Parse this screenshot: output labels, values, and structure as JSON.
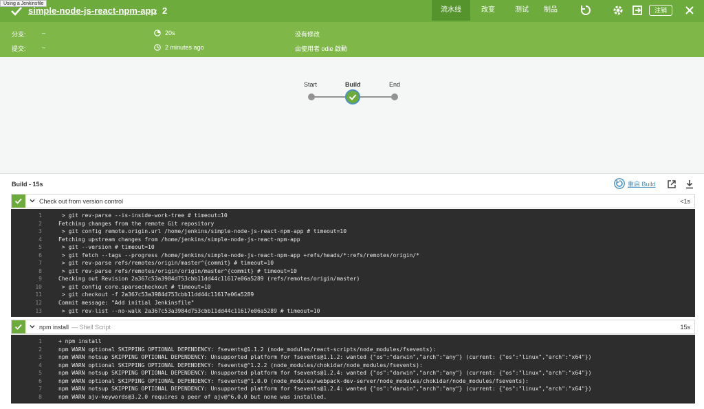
{
  "tooltip": "Using a Jenkinsfile",
  "header": {
    "pipeline_name": "simple-node-js-react-npm-app",
    "run_number": "2",
    "tabs": [
      "流水线",
      "改变",
      "测试",
      "制品"
    ],
    "logout_label": "注销"
  },
  "meta": {
    "branch_label": "分支:",
    "branch_value": "–",
    "commit_label": "提交:",
    "commit_value": "–",
    "duration": "20s",
    "started": "2 minutes ago",
    "changes": "没有修改",
    "started_by": "由使用者 odie 啟動"
  },
  "pipeline_graph": {
    "stages": [
      "Start",
      "Build",
      "End"
    ]
  },
  "build_panel": {
    "title": "Build - 15s",
    "restart_label": "重启 Build"
  },
  "steps": [
    {
      "name": "Check out from version control",
      "subtitle": "",
      "duration": "<1s",
      "log": [
        " > git rev-parse --is-inside-work-tree # timeout=10",
        "Fetching changes from the remote Git repository",
        " > git config remote.origin.url /home/jenkins/simple-node-js-react-npm-app # timeout=10",
        "Fetching upstream changes from /home/jenkins/simple-node-js-react-npm-app",
        " > git --version # timeout=10",
        " > git fetch --tags --progress /home/jenkins/simple-node-js-react-npm-app +refs/heads/*:refs/remotes/origin/*",
        " > git rev-parse refs/remotes/origin/master^{commit} # timeout=10",
        " > git rev-parse refs/remotes/origin/origin/master^{commit} # timeout=10",
        "Checking out Revision 2a367c53a3984d753cbb11dd44c11617e06a5289 (refs/remotes/origin/master)",
        " > git config core.sparsecheckout # timeout=10",
        " > git checkout -f 2a367c53a3984d753cbb11dd44c11617e06a5289",
        "Commit message: \"Add initial Jenkinsfile\"",
        " > git rev-list --no-walk 2a367c53a3984d753cbb11dd44c11617e06a5289 # timeout=10"
      ]
    },
    {
      "name": "npm install",
      "subtitle": "— Shell Script",
      "duration": "15s",
      "log": [
        "+ npm install",
        "npm WARN optional SKIPPING OPTIONAL DEPENDENCY: fsevents@1.1.2 (node_modules/react-scripts/node_modules/fsevents):",
        "npm WARN notsup SKIPPING OPTIONAL DEPENDENCY: Unsupported platform for fsevents@1.1.2: wanted {\"os\":\"darwin\",\"arch\":\"any\"} (current: {\"os\":\"linux\",\"arch\":\"x64\"})",
        "npm WARN optional SKIPPING OPTIONAL DEPENDENCY: fsevents@^1.2.2 (node_modules/chokidar/node_modules/fsevents):",
        "npm WARN notsup SKIPPING OPTIONAL DEPENDENCY: Unsupported platform for fsevents@1.2.4: wanted {\"os\":\"darwin\",\"arch\":\"any\"} (current: {\"os\":\"linux\",\"arch\":\"x64\"})",
        "npm WARN optional SKIPPING OPTIONAL DEPENDENCY: fsevents@^1.0.0 (node_modules/webpack-dev-server/node_modules/chokidar/node_modules/fsevents):",
        "npm WARN notsup SKIPPING OPTIONAL DEPENDENCY: Unsupported platform for fsevents@1.2.4: wanted {\"os\":\"darwin\",\"arch\":\"any\"} (current: {\"os\":\"linux\",\"arch\":\"x64\"})",
        "npm WARN ajv-keywords@3.2.0 requires a peer of ajv@^6.0.0 but none was installed."
      ]
    }
  ],
  "colors": {
    "header_green": "#6cab3c",
    "meta_green": "#7fb849",
    "active_tab": "#55942d",
    "link_blue": "#4a90c2",
    "log_bg": "#2d2d2d"
  }
}
